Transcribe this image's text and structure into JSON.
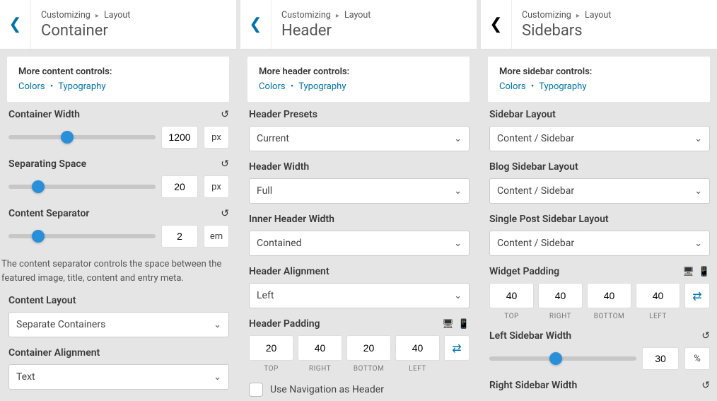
{
  "breadcrumb": {
    "root": "Customizing",
    "sub": "Layout"
  },
  "container": {
    "title": "Container",
    "info_title": "More content controls:",
    "links": {
      "colors": "Colors",
      "typography": "Typography"
    },
    "width": {
      "label": "Container Width",
      "value": "1200",
      "unit": "px",
      "pct": 40
    },
    "space": {
      "label": "Separating Space",
      "value": "20",
      "unit": "px",
      "pct": 20
    },
    "separator": {
      "label": "Content Separator",
      "value": "2",
      "unit": "em",
      "pct": 20
    },
    "help": "The content separator controls the space between the featured image, title, content and entry meta.",
    "layout": {
      "label": "Content Layout",
      "value": "Separate Containers"
    },
    "alignment": {
      "label": "Container Alignment",
      "value": "Text"
    }
  },
  "header": {
    "title": "Header",
    "info_title": "More header controls:",
    "links": {
      "colors": "Colors",
      "typography": "Typography"
    },
    "presets": {
      "label": "Header Presets",
      "value": "Current"
    },
    "width": {
      "label": "Header Width",
      "value": "Full"
    },
    "inner": {
      "label": "Inner Header Width",
      "value": "Contained"
    },
    "alignment": {
      "label": "Header Alignment",
      "value": "Left"
    },
    "padding": {
      "label": "Header Padding",
      "top": "20",
      "right": "40",
      "bottom": "20",
      "left": "40",
      "l_top": "TOP",
      "l_right": "RIGHT",
      "l_bottom": "BOTTOM",
      "l_left": "LEFT"
    },
    "use_nav": "Use Navigation as Header"
  },
  "sidebars": {
    "title": "Sidebars",
    "info_title": "More sidebar controls:",
    "links": {
      "colors": "Colors",
      "typography": "Typography"
    },
    "layout": {
      "label": "Sidebar Layout",
      "value": "Content / Sidebar"
    },
    "blog": {
      "label": "Blog Sidebar Layout",
      "value": "Content / Sidebar"
    },
    "single": {
      "label": "Single Post Sidebar Layout",
      "value": "Content / Sidebar"
    },
    "widget_padding": {
      "label": "Widget Padding",
      "top": "40",
      "right": "40",
      "bottom": "40",
      "left": "40",
      "l_top": "TOP",
      "l_right": "RIGHT",
      "l_bottom": "BOTTOM",
      "l_left": "LEFT"
    },
    "left_width": {
      "label": "Left Sidebar Width",
      "value": "30",
      "unit": "%",
      "pct": 45
    },
    "right_width": {
      "label": "Right Sidebar Width"
    }
  }
}
